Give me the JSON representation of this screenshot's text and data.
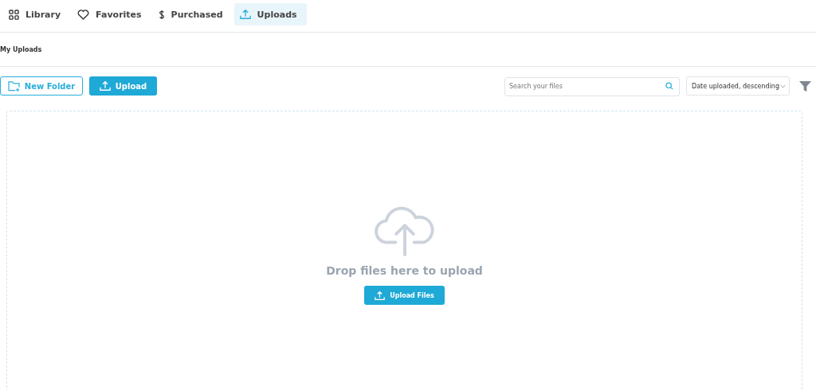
{
  "tabs": [
    {
      "label": "Library",
      "kind": "grid",
      "selected": false
    },
    {
      "label": "Favorites",
      "kind": "heart",
      "selected": false
    },
    {
      "label": "Purchased",
      "kind": "dollar",
      "selected": false
    },
    {
      "label": "Uploads",
      "kind": "upload",
      "selected": true
    }
  ],
  "heading": "My Uploads",
  "toolbar": {
    "new_folder": "New Folder",
    "upload": "Upload",
    "search": {
      "placeholder": "Search your files"
    },
    "sort": "Date uploaded, descending"
  },
  "dropzone": {
    "message": "Drop files here to upload",
    "button": "Upload Files"
  }
}
